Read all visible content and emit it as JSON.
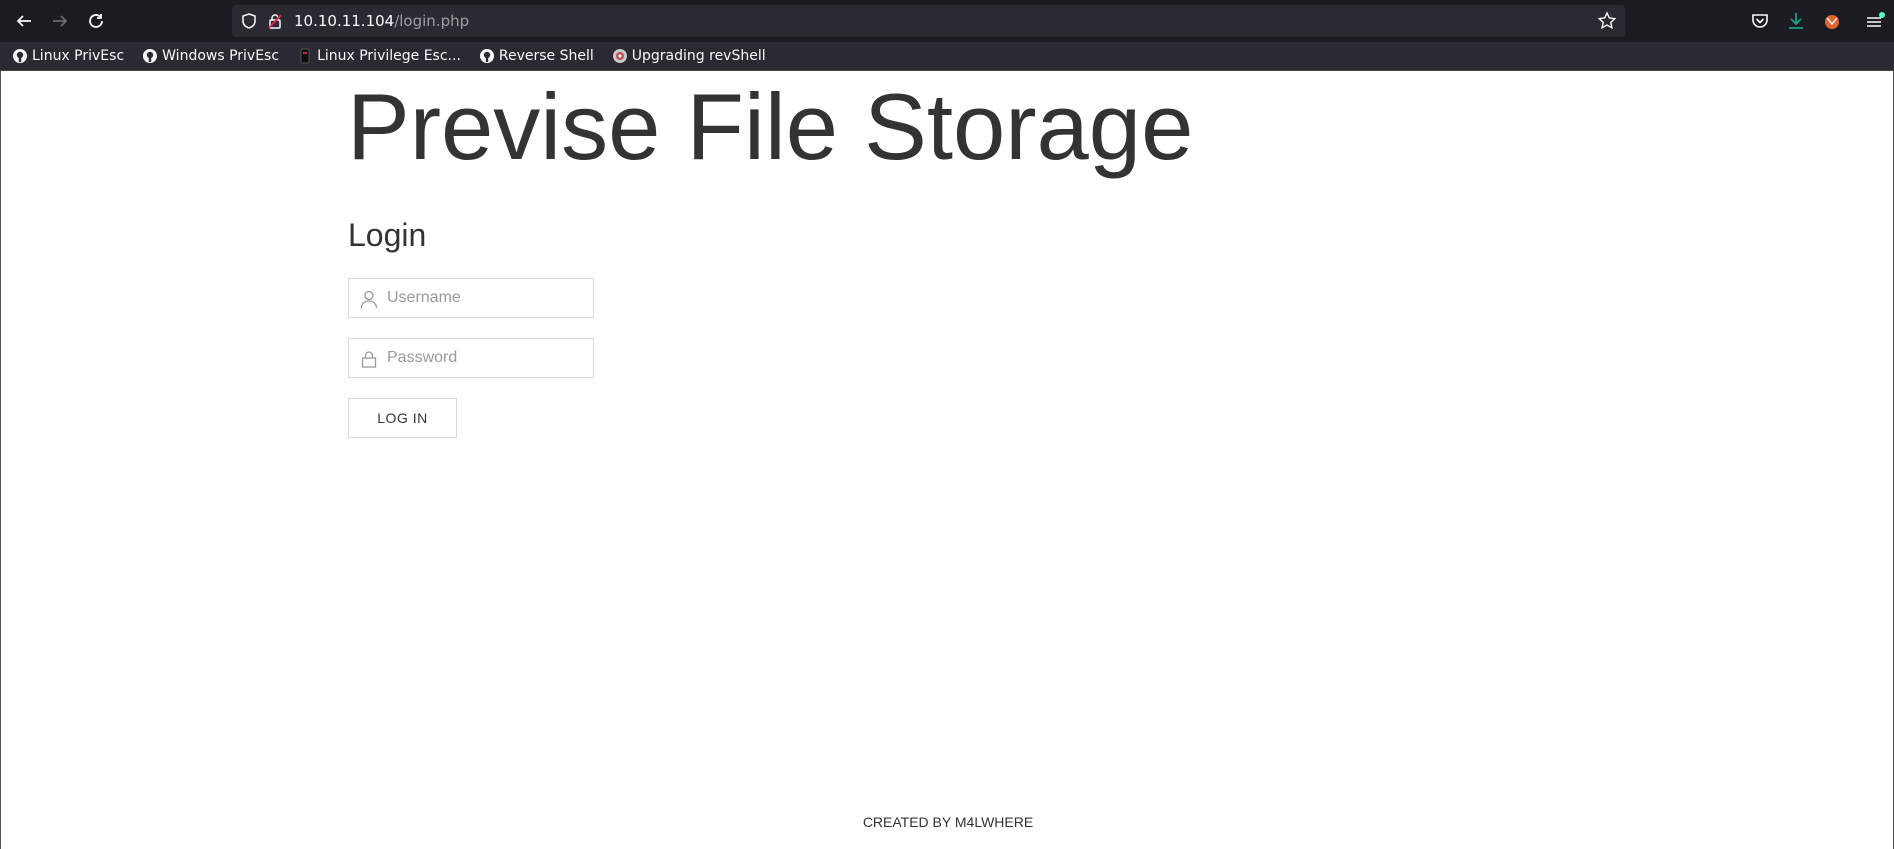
{
  "browser": {
    "url_host": "10.10.11.104",
    "url_path": "/login.php",
    "nav": {
      "back_icon": "arrow-left-icon",
      "forward_icon": "arrow-right-icon",
      "reload_icon": "reload-icon"
    },
    "bookmarks": [
      {
        "label": "Linux PrivEsc",
        "icon": "github-icon"
      },
      {
        "label": "Windows PrivEsc",
        "icon": "github-icon"
      },
      {
        "label": "Linux Privilege Esc...",
        "icon": "page-icon"
      },
      {
        "label": "Reverse Shell",
        "icon": "github-icon"
      },
      {
        "label": "Upgrading revShell",
        "icon": "site-icon"
      }
    ],
    "accent_color": "#fbfbfe"
  },
  "page": {
    "title": "Previse File Storage",
    "login_heading": "Login",
    "username_placeholder": "Username",
    "password_placeholder": "Password",
    "login_button": "LOG IN",
    "footer": "CREATED BY M4LWHERE"
  }
}
